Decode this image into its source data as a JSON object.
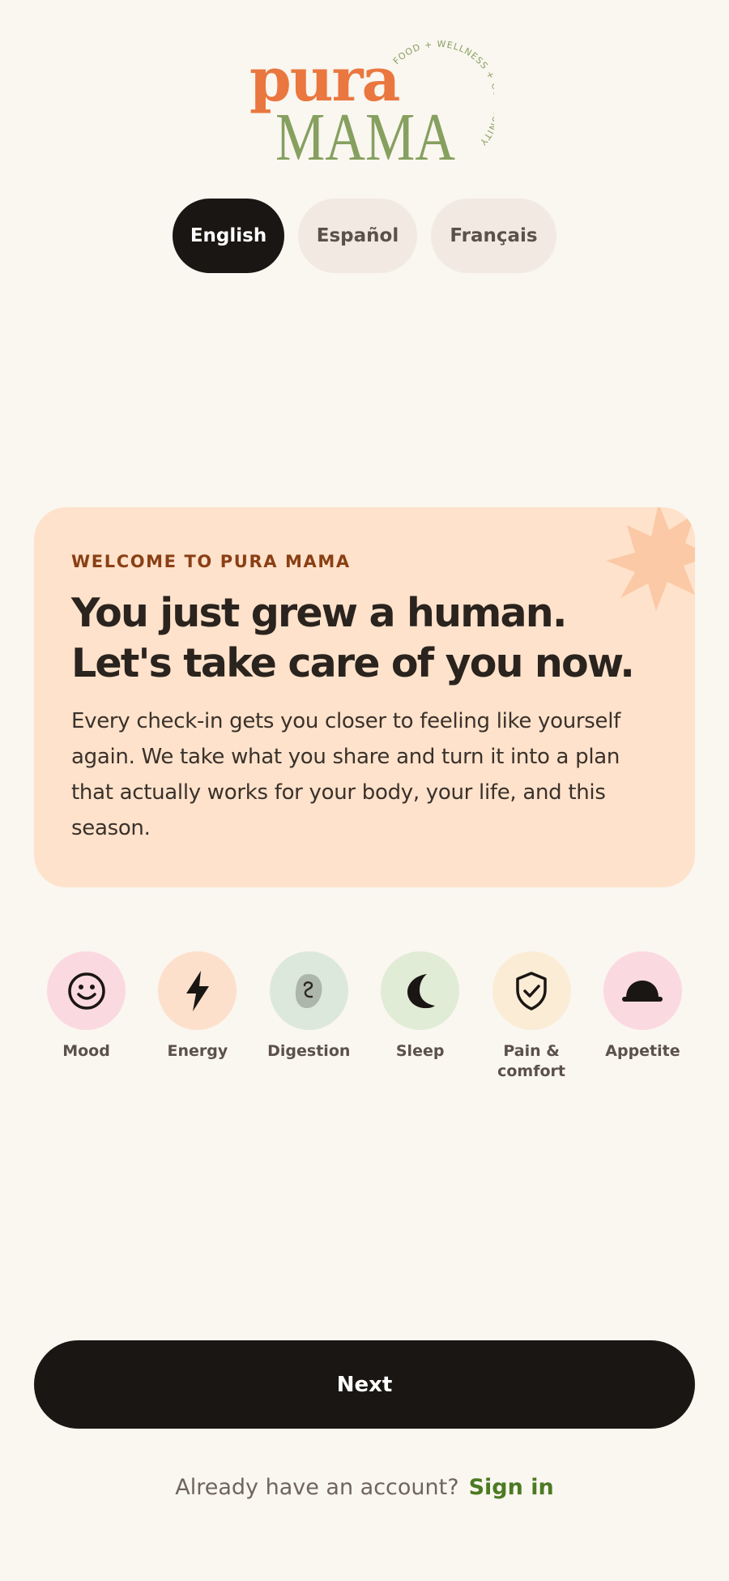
{
  "logo": {
    "word_top": "pura",
    "word_bottom": "MAMA",
    "tagline": "FOOD + WELLNESS + COMMUNITY"
  },
  "languages": [
    {
      "label": "English",
      "selected": true
    },
    {
      "label": "Español",
      "selected": false
    },
    {
      "label": "Français",
      "selected": false
    }
  ],
  "welcome_card": {
    "eyebrow": "WELCOME TO PURA MAMA",
    "title": "You just grew a human. Let's take care of you now.",
    "body": "Every check-in gets you closer to feeling like yourself again. We take what you share and turn it into a plan that actually works for your body, your life, and this season."
  },
  "categories": [
    {
      "label": "Mood",
      "icon": "smiley-icon",
      "color": "#fbd9e1"
    },
    {
      "label": "Energy",
      "icon": "lightning-icon",
      "color": "#fde0cc"
    },
    {
      "label": "Digestion",
      "icon": "stomach-icon",
      "color": "#dce8dc"
    },
    {
      "label": "Sleep",
      "icon": "moon-icon",
      "color": "#e0ecd6"
    },
    {
      "label": "Pain & comfort",
      "icon": "shield-check-icon",
      "color": "#fbecd6"
    },
    {
      "label": "Appetite",
      "icon": "bowl-icon",
      "color": "#fbd9e1"
    }
  ],
  "next_button": {
    "label": "Next"
  },
  "signin": {
    "prompt": "Already have an account?",
    "link": "Sign in"
  },
  "colors": {
    "background": "#faf6f0",
    "card": "#fee2cb",
    "dark": "#1a1613",
    "brand_orange": "#e9773f",
    "brand_green": "#86a05f",
    "link_green": "#4c7a22"
  }
}
